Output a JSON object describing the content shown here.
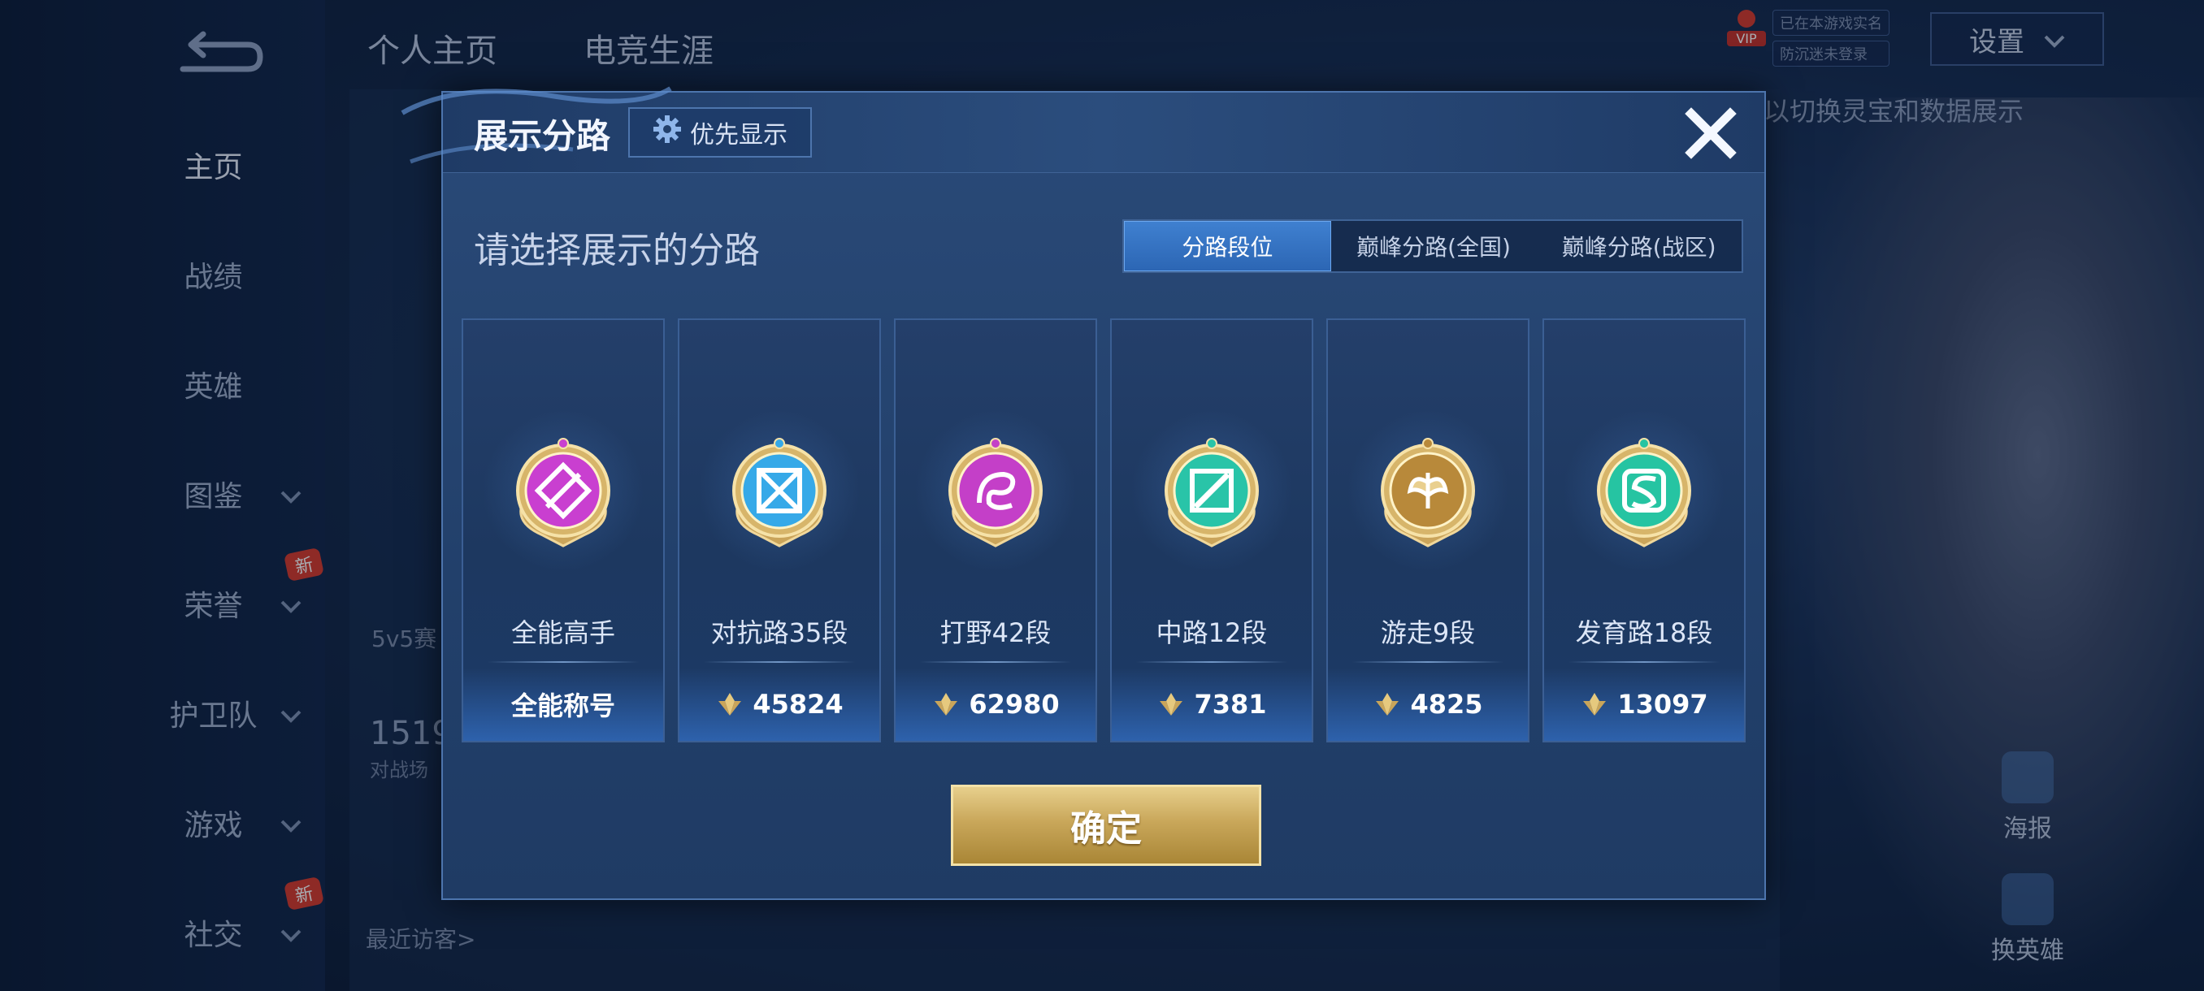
{
  "background": {
    "top_nav": [
      "个人主页",
      "电竞生涯"
    ],
    "sidebar": [
      {
        "label": "主页",
        "active": true,
        "chevron": false,
        "new": false
      },
      {
        "label": "战绩",
        "active": false,
        "chevron": false,
        "new": false
      },
      {
        "label": "英雄",
        "active": false,
        "chevron": false,
        "new": false
      },
      {
        "label": "图鉴",
        "active": false,
        "chevron": true,
        "new": false
      },
      {
        "label": "荣誉",
        "active": false,
        "chevron": true,
        "new": true
      },
      {
        "label": "护卫队",
        "active": false,
        "chevron": true,
        "new": false
      },
      {
        "label": "游戏",
        "active": false,
        "chevron": true,
        "new": false
      },
      {
        "label": "社交",
        "active": false,
        "chevron": true,
        "new": true
      }
    ],
    "new_badge": "新",
    "settings_label": "设置",
    "vip_label": "VIP",
    "vip_lines": [
      "已在本游戏实名",
      "防沉迷未登录"
    ],
    "hint": "以切换灵宝和数据展示",
    "mode_label": "5v5赛",
    "stat_number": "1519",
    "stat_sub": "对战场",
    "recent_visitors": "最近访客>",
    "poster_label": "海报",
    "switch_hero_label": "换英雄"
  },
  "modal": {
    "title": "展示分路",
    "priority_button": "优先显示",
    "subtitle": "请选择展示的分路",
    "tabs": [
      {
        "label": "分路段位",
        "active": true
      },
      {
        "label": "巅峰分路(全国)",
        "active": false
      },
      {
        "label": "巅峰分路(战区)",
        "active": false
      }
    ],
    "cards": [
      {
        "rank": "全能高手",
        "score": "全能称号",
        "has_score_icon": false,
        "medal_color": "#c93fd0",
        "medal_icon": "all-round-medal-icon"
      },
      {
        "rank": "对抗路35段",
        "score": "45824",
        "has_score_icon": true,
        "medal_color": "#36a9e8",
        "medal_icon": "clash-lane-medal-icon"
      },
      {
        "rank": "打野42段",
        "score": "62980",
        "has_score_icon": true,
        "medal_color": "#c43fc8",
        "medal_icon": "jungle-medal-icon"
      },
      {
        "rank": "中路12段",
        "score": "7381",
        "has_score_icon": true,
        "medal_color": "#29c4a8",
        "medal_icon": "mid-lane-medal-icon"
      },
      {
        "rank": "游走9段",
        "score": "4825",
        "has_score_icon": true,
        "medal_color": "#b8893a",
        "medal_icon": "roam-medal-icon"
      },
      {
        "rank": "发育路18段",
        "score": "13097",
        "has_score_icon": true,
        "medal_color": "#26c4a2",
        "medal_icon": "farm-lane-medal-icon"
      }
    ],
    "confirm_button": "确定"
  },
  "colors": {
    "gold": "#e7cf8c",
    "tab_active": "#3f80d0",
    "panel": "#22406b"
  }
}
